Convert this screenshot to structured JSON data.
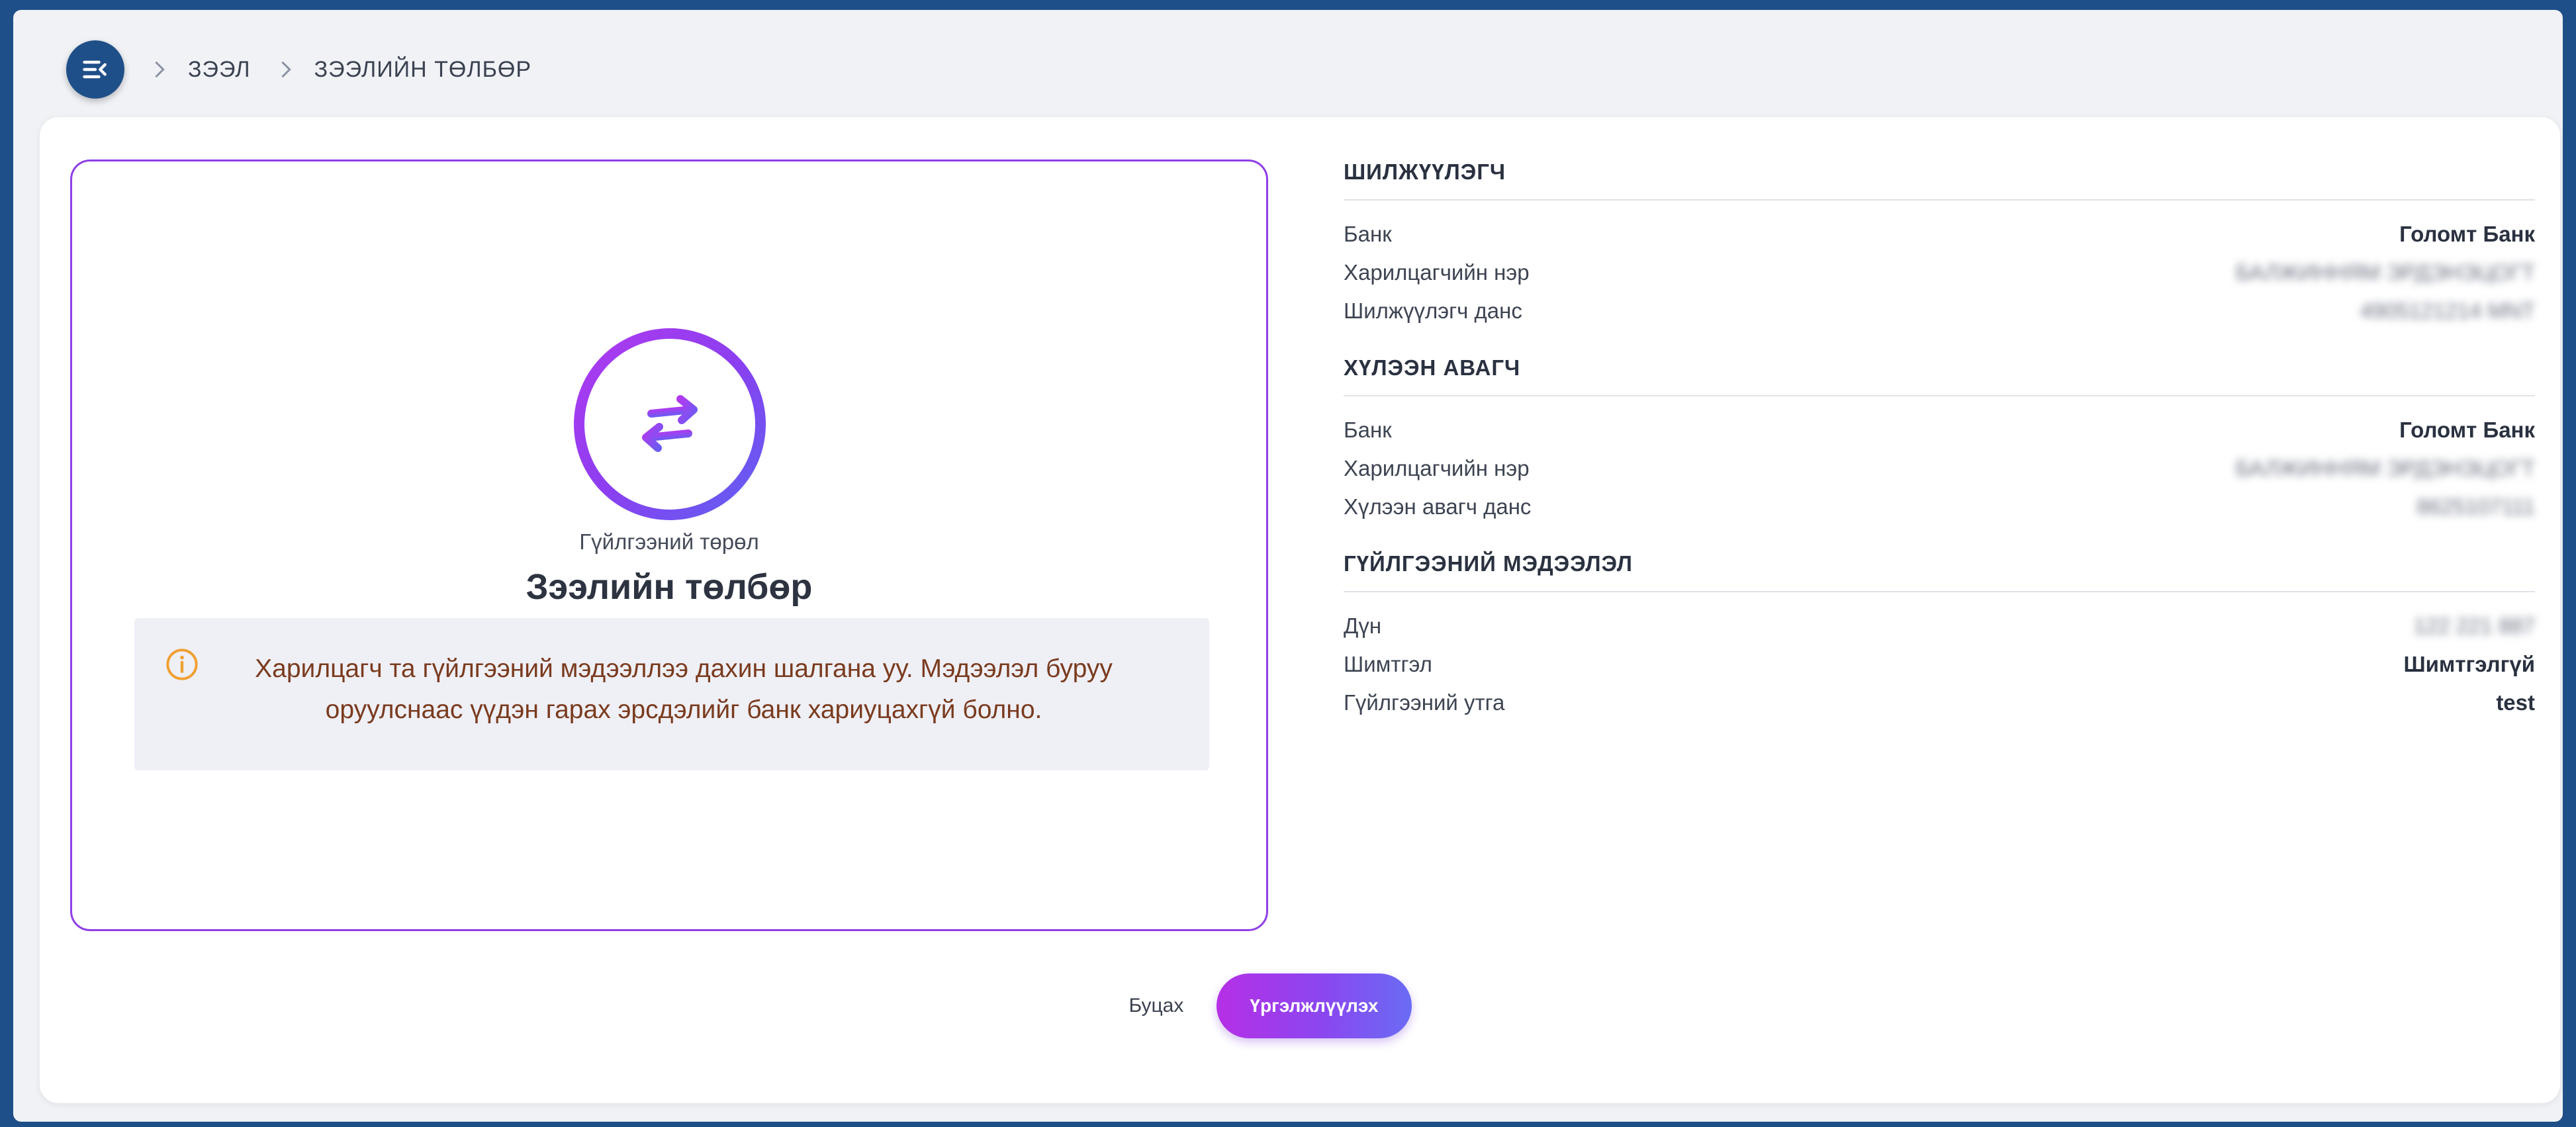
{
  "header": {
    "breadcrumb": [
      "ЗЭЭЛ",
      "ЗЭЭЛИЙН ТӨЛБӨР"
    ]
  },
  "summary": {
    "type_label": "Гүйлгээний төрөл",
    "type_value": "Зээлийн төлбөр",
    "notice": "Харилцагч та гүйлгээний мэдээллээ дахин шалгана уу. Мэдээлэл буруу оруулснаас үүдэн гарах эрсдэлийг банк хариуцахгүй болно."
  },
  "sender": {
    "title": "ШИЛЖҮҮЛЭГЧ",
    "rows": [
      {
        "label": "Банк",
        "value": "Голомт Банк"
      },
      {
        "label": "Харилцагчийн нэр",
        "value": "БАЛЖИННЯМ ЭРДЭНЭЦОГТ"
      },
      {
        "label": "Шилжүүлэгч данс",
        "value": "4905121214 MNT"
      }
    ]
  },
  "receiver": {
    "title": "ХҮЛЭЭН АВАГЧ",
    "rows": [
      {
        "label": "Банк",
        "value": "Голомт Банк"
      },
      {
        "label": "Харилцагчийн нэр",
        "value": "БАЛЖИННЯМ ЭРДЭНЭЦОГТ"
      },
      {
        "label": "Хүлээн авагч данс",
        "value": "8625107111"
      }
    ]
  },
  "transaction": {
    "title": "ГҮЙЛГЭЭНИЙ МЭДЭЭЛЭЛ",
    "rows": [
      {
        "label": "Дүн",
        "value": "122 221 887"
      },
      {
        "label": "Шимтгэл",
        "value": "Шимтгэлгүй"
      },
      {
        "label": "Гүйлгээний утга",
        "value": "test"
      }
    ]
  },
  "actions": {
    "back": "Буцах",
    "continue": "Үргэлжлүүлэх"
  },
  "colors": {
    "accent": "#8f3fe6",
    "brand": "#1f4f88",
    "notice_text": "#7a3b1e",
    "warning_icon": "#f0a030"
  }
}
